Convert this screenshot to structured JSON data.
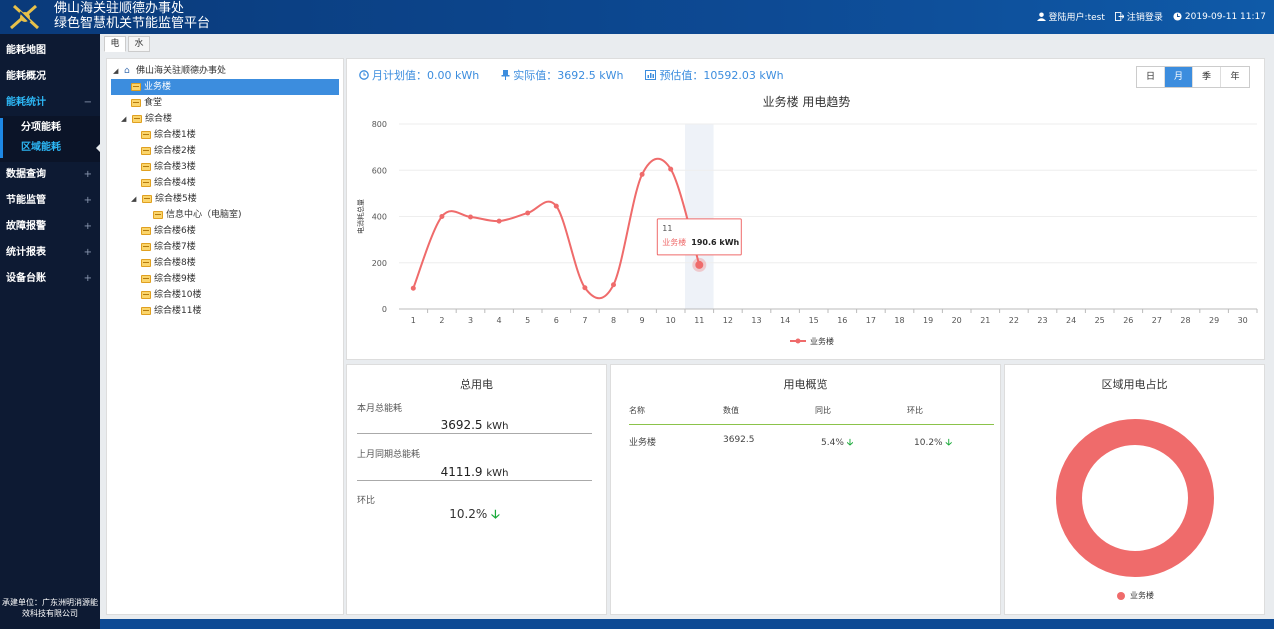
{
  "header": {
    "title_line1": "佛山海关驻顺德办事处",
    "title_line2": "绿色智慧机关节能监管平台",
    "user": "登陆用户:test",
    "logout": "注销登录",
    "datetime": "2019-09-11 11:17"
  },
  "sidebar": {
    "items": [
      {
        "label": "能耗地图"
      },
      {
        "label": "能耗概况"
      },
      {
        "label": "能耗统计",
        "toggle": "−"
      },
      {
        "label": "数据查询",
        "toggle": "+"
      },
      {
        "label": "节能监管",
        "toggle": "+"
      },
      {
        "label": "故障报警",
        "toggle": "+"
      },
      {
        "label": "统计报表",
        "toggle": "+"
      },
      {
        "label": "设备台账",
        "toggle": "+"
      }
    ],
    "subitems": [
      {
        "label": "分项能耗"
      },
      {
        "label": "区域能耗"
      }
    ],
    "footer": "承建单位：广东洲明消源能效科技有限公司"
  },
  "tabs": [
    {
      "label": "电"
    },
    {
      "label": "水"
    }
  ],
  "tree": [
    {
      "label": "佛山海关驻顺德办事处"
    },
    {
      "label": "业务楼"
    },
    {
      "label": "食堂"
    },
    {
      "label": "综合楼"
    },
    {
      "label": "综合楼1楼"
    },
    {
      "label": "综合楼2楼"
    },
    {
      "label": "综合楼3楼"
    },
    {
      "label": "综合楼4楼"
    },
    {
      "label": "综合楼5楼"
    },
    {
      "label": "信息中心（电脑室)"
    },
    {
      "label": "综合楼6楼"
    },
    {
      "label": "综合楼7楼"
    },
    {
      "label": "综合楼8楼"
    },
    {
      "label": "综合楼9楼"
    },
    {
      "label": "综合楼10楼"
    },
    {
      "label": "综合楼11楼"
    }
  ],
  "stats": {
    "plan": "月计划值：0.00 kWh",
    "actual": "实际值：3692.5 kWh",
    "forecast": "预估值：10592.03 kWh"
  },
  "period_buttons": [
    "日",
    "月",
    "季",
    "年"
  ],
  "chart_data": {
    "type": "line",
    "title": "业务楼 用电趋势",
    "ylabel": "电消耗总量",
    "xlabel": "",
    "x": [
      "1",
      "2",
      "3",
      "4",
      "5",
      "6",
      "7",
      "8",
      "9",
      "10",
      "11",
      "12",
      "13",
      "14",
      "15",
      "16",
      "17",
      "18",
      "19",
      "20",
      "21",
      "22",
      "23",
      "24",
      "25",
      "26",
      "27",
      "28",
      "29",
      "30"
    ],
    "ylim": [
      0,
      800
    ],
    "yticks": [
      0,
      200,
      400,
      600,
      800
    ],
    "series": [
      {
        "name": "业务楼",
        "values": [
          90,
          400,
          398,
          380,
          415,
          445,
          92,
          105,
          582,
          605,
          190.6
        ],
        "color": "#ef6b6b"
      }
    ],
    "tooltip": {
      "x": "11",
      "series": "业务楼",
      "value": "190.6 kWh"
    },
    "highlight_x": "11",
    "grid": true,
    "legend": "bottom-center"
  },
  "total": {
    "title": "总用电",
    "month_label": "本月总能耗",
    "month_value": "3692.5",
    "unit": "kWh",
    "last_label": "上月同期总能耗",
    "last_value": "4111.9",
    "ratio_label": "环比",
    "ratio_value": "10.2%"
  },
  "overview": {
    "title": "用电概览",
    "headers": [
      "名称",
      "数值",
      "同比",
      "环比"
    ],
    "row": {
      "name": "业务楼",
      "value": "3692.5",
      "yoy": "5.4%",
      "mom": "10.2%"
    }
  },
  "share": {
    "title": "区域用电占比",
    "legend": "业务楼",
    "slices": [
      {
        "name": "业务楼",
        "value": 100,
        "color": "#ef6b6b"
      }
    ]
  },
  "colors": {
    "accent": "#3c8dde",
    "series": "#ef6b6b",
    "down": "#1aaa3a"
  }
}
